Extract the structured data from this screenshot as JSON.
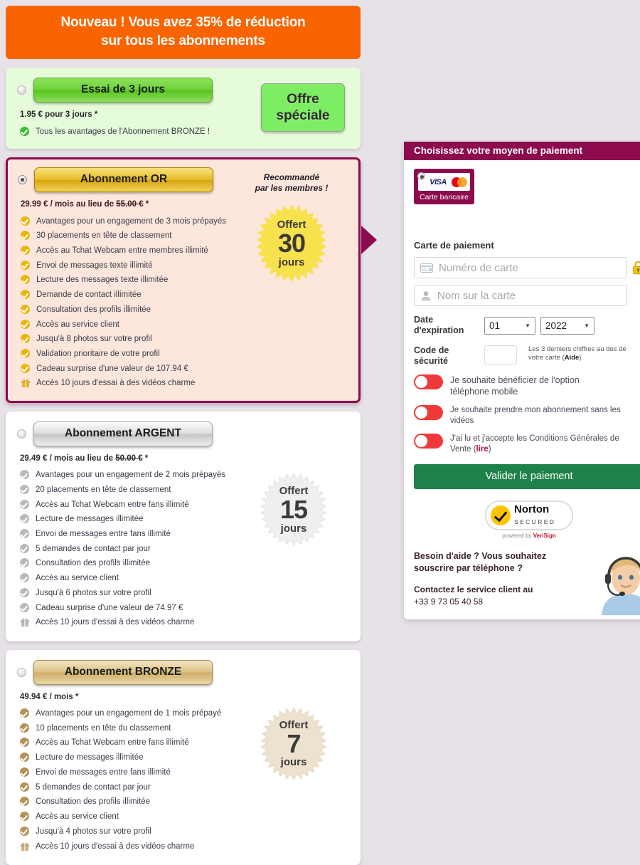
{
  "promo": {
    "line1": "Nouveau ! Vous avez 35% de réduction",
    "line2": "sur tous les abonnements",
    "color": "#fa6400"
  },
  "plans": [
    {
      "id": "trial",
      "button_label": "Essai de 3 jours",
      "price": "1.95 € pour 3 jours *",
      "selected": false,
      "features": [
        "Tous les avantages de l'Abonnement BRONZE !"
      ],
      "side_button": {
        "line1": "Offre",
        "line2": "spéciale"
      }
    },
    {
      "id": "gold",
      "button_label": "Abonnement OR",
      "price_now": "29.99 € / mois au lieu de ",
      "price_old": "55.00 €",
      "price_star": " *",
      "selected": true,
      "recommended_l1": "Recommandé",
      "recommended_l2": "par les membres !",
      "badge": {
        "label": "Offert",
        "number": "30",
        "unit": "jours"
      },
      "features": [
        "Avantages pour un engagement de 3 mois prépayés",
        "30 placements en tête de classement",
        "Accès au Tchat Webcam entre membres illimité",
        "Envoi de messages texte illimité",
        "Lecture des messages texte illimitée",
        "Demande de contact illimitée",
        "Consultation des profils illimitée",
        "Accès au service client",
        "Jusqu'à 8 photos sur votre profil",
        "Validation prioritaire de votre profil",
        "Cadeau surprise d'une valeur de 107.94 €"
      ],
      "gift_feature": "Accès 10 jours d'essai à des vidéos charme"
    },
    {
      "id": "silver",
      "button_label": "Abonnement ARGENT",
      "price_now": "29.49 € / mois au lieu de ",
      "price_old": "50.00 €",
      "price_star": " *",
      "selected": false,
      "badge": {
        "label": "Offert",
        "number": "15",
        "unit": "jours"
      },
      "features": [
        "Avantages pour un engagement de 2 mois prépayés",
        "20 placements en tête de classement",
        "Accès au Tchat Webcam entre fans illimité",
        "Lecture de messages illimitée",
        "Envoi de messages entre fans illimité",
        "5 demandes de contact par jour",
        "Consultation des profils illimitée",
        "Accès au service client",
        "Jusqu'à 6 photos sur votre profil",
        "Cadeau surprise d'une valeur de 74.97 €"
      ],
      "gift_feature": "Accès 10 jours d'essai à des vidéos charme"
    },
    {
      "id": "bronze",
      "button_label": "Abonnement BRONZE",
      "price_now": "49.94 € / mois *",
      "price_old": "",
      "price_star": "",
      "selected": false,
      "badge": {
        "label": "Offert",
        "number": "7",
        "unit": "jours"
      },
      "features": [
        "Avantages pour un engagement de 1 mois prépayé",
        "10 placements en tête du classement",
        "Accès au Tchat Webcam entre fans illimité",
        "Lecture de messages illimitée",
        "Envoi de messages entre fans illimité",
        "5 demandes de contact par jour",
        "Consultation des profils illimitée",
        "Accès au service client",
        "Jusqu'à 4 photos sur votre profil"
      ],
      "gift_feature": "Accès 10 jours d'essai à des vidéos charme"
    }
  ],
  "payment": {
    "header": "Choisissez votre moyen de paiement",
    "header_color": "#8c0a4d",
    "method": {
      "label": "Carte bancaire",
      "visa": "VISA",
      "selected": true
    },
    "section_title": "Carte de paiement",
    "card_number_placeholder": "Numéro de carte",
    "card_number_value": "",
    "card_name_placeholder": "Nom sur la carte",
    "card_name_value": "",
    "expiry_label_l1": "Date",
    "expiry_label_l2": "d'expiration",
    "expiry_month": "01",
    "expiry_year": "2022",
    "cvv_label_l1": "Code de",
    "cvv_label_l2": "sécurité",
    "cvv_value": "",
    "cvv_hint_l1": "Les 3 derniers chiffres au dos de",
    "cvv_hint_l2": "votre carte (",
    "cvv_hint_help": "Aide",
    "cvv_hint_l3": ")",
    "toggles": [
      {
        "text_l1": "Je souhaite bénéficier de l'option",
        "text_l2": "téléphone mobile",
        "on": true,
        "size": "big"
      },
      {
        "text_l1": "Je souhaite prendre mon abonnement sans les",
        "text_l2": "vidéos",
        "on": true,
        "size": "small"
      },
      {
        "text_l1": "J'ai lu et j'accepte les Conditions Générales de",
        "text_l2": "Vente (",
        "link": "lire",
        "text_l3": ")",
        "on": true,
        "size": "small"
      }
    ],
    "validate_label": "Valider le paiement",
    "validate_color": "#1e8248",
    "norton": {
      "word1": "Norton",
      "word2": "SECURED",
      "powered": "powered by ",
      "brand": "VeriSign"
    },
    "help": {
      "question_l1": "Besoin d'aide ? Vous souhaitez souscrire par",
      "question_l2": "téléphone ?",
      "contact": "Contactez le service client au",
      "phone": "+33 9 73 05 40 58"
    }
  }
}
